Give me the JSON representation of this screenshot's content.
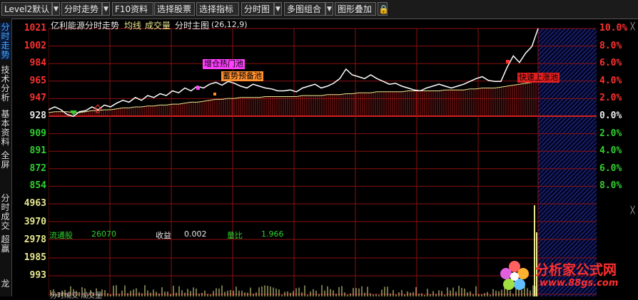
{
  "toolbar": {
    "items": [
      "Level2默认",
      "分时走势",
      "F10资料",
      "选择股票",
      "选择指标",
      "分时图",
      "多图组合",
      "图形叠加"
    ]
  },
  "sidebar": {
    "tabs": [
      "分时走势",
      "技术分析",
      "基本资料",
      "全屏",
      "分时成交",
      "超赢",
      "龙"
    ]
  },
  "chart_header": {
    "stock_name": "亿利能源分时走势",
    "avg_label": "均线",
    "volume_label": "成交量",
    "main_label": "分时主图",
    "params": "(26,12,9)"
  },
  "price_axis": [
    "1021",
    "1002",
    "984",
    "965",
    "947",
    "928",
    "909",
    "891",
    "872",
    "854"
  ],
  "percent_axis": [
    "10.0%",
    "8.0%",
    "6.0%",
    "4.0%",
    "2.0%",
    "0.0%",
    "2.0%",
    "4.0%",
    "6.0%",
    "8.0%"
  ],
  "volume_axis": [
    "4963",
    "3970",
    "2978",
    "1985",
    "993"
  ],
  "tags": {
    "hot_pool": "增仓热门池",
    "reserve_pool": "蓄势预备池",
    "limit_pool": "快速上涨池"
  },
  "info_bar": {
    "float_label": "流通股",
    "float_value": "26070",
    "eps_label": "收益",
    "eps_value": "0.002",
    "ratio_label": "量比",
    "ratio_value": "1.966"
  },
  "footer_text": "分时成交 成交量",
  "watermark": {
    "name": "分析家公式网",
    "url": "www.88gs.com"
  },
  "colors": {
    "up": "#ff3030",
    "down": "#30d030",
    "grid": "#8b1010",
    "price_line": "#ffffff",
    "avg_line": "#e8e890",
    "volume": "#e8e890"
  },
  "chart_data": {
    "type": "line",
    "title": "亿利能源分时走势",
    "prev_close": 928,
    "price_range": [
      854,
      1021
    ],
    "series": [
      {
        "name": "分时主图",
        "values": [
          935,
          938,
          935,
          930,
          928,
          933,
          934,
          938,
          935,
          940,
          938,
          942,
          945,
          943,
          948,
          945,
          950,
          948,
          952,
          950,
          955,
          953,
          958,
          955,
          960,
          958,
          962,
          964,
          961,
          965,
          963,
          960,
          958,
          962,
          960,
          958,
          957,
          955,
          955,
          956,
          954,
          958,
          960,
          962,
          958,
          960,
          963,
          968,
          978,
          972,
          970,
          968,
          972,
          968,
          965,
          962,
          963,
          960,
          958,
          956,
          955,
          958,
          960,
          962,
          960,
          958,
          960,
          962,
          965,
          968,
          970,
          966,
          965,
          965,
          980,
          992,
          985,
          995,
          1002,
          1021
        ]
      },
      {
        "name": "均线",
        "values": [
          932,
          933,
          933,
          933,
          932,
          932,
          933,
          934,
          934,
          935,
          935,
          936,
          937,
          937,
          938,
          938,
          939,
          939,
          940,
          940,
          941,
          941,
          942,
          943,
          943,
          944,
          945,
          946,
          946,
          947,
          947,
          948,
          948,
          948,
          948,
          949,
          949,
          949,
          949,
          949,
          949,
          950,
          950,
          950,
          950,
          951,
          951,
          951,
          952,
          952,
          953,
          953,
          953,
          954,
          954,
          954,
          954,
          954,
          955,
          955,
          955,
          955,
          955,
          955,
          956,
          956,
          956,
          956,
          957,
          957,
          958,
          958,
          958,
          959,
          960,
          961,
          962,
          963,
          964,
          966
        ]
      }
    ]
  }
}
